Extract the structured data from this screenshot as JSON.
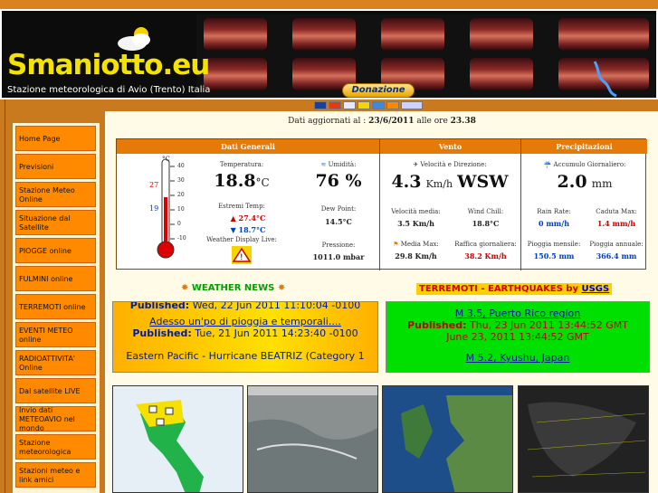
{
  "header": {
    "logo_text": "Smaniotto.eu",
    "subtitle": "Stazione meteorologica di Avio (Trento) Italia",
    "donate_label": "Donazione"
  },
  "colors": {
    "accent": "#e67a08",
    "nav": "#ff8a00",
    "logo": "#f4e200"
  },
  "nav": [
    {
      "label": "Home Page"
    },
    {
      "label": "Previsioni"
    },
    {
      "label": "Stazione Meteo Online"
    },
    {
      "label": "Situazione dal Satellite"
    },
    {
      "label": "PIOGGE online"
    },
    {
      "label": "FULMINI online"
    },
    {
      "label": "TERREMOTI online"
    },
    {
      "label": "EVENTI METEO online"
    },
    {
      "label": "RADIOATTIVITA' Online"
    },
    {
      "label": "Dal satellite LIVE"
    },
    {
      "label": "Invio dati METEOAVIO nel mondo"
    },
    {
      "label": "Stazione meteorologica"
    },
    {
      "label": "Stazioni meteo e link amici"
    }
  ],
  "updated": {
    "prefix": "Dati aggiornati al :",
    "date": "23/6/2011",
    "mid": "alle ore",
    "time": "23.38"
  },
  "weather": {
    "headers": {
      "generali": "Dati Generali",
      "vento": "Vento",
      "precip": "Precipitazioni"
    },
    "thermo": {
      "max": "27",
      "min": "19",
      "scale": [
        "40",
        "30",
        "20",
        "10",
        "0",
        "-10"
      ],
      "unit": "°C"
    },
    "temp_label": "Temperatura:",
    "temp_value": "18.8",
    "temp_unit": "°C",
    "hum_label": "Umidità:",
    "hum_value": "76 %",
    "extremes_label": "Estremi Temp:",
    "temp_max": "27.4°C",
    "temp_min": "18.7°C",
    "dew_label": "Dew Point:",
    "dew_value": "14.5°C",
    "display_label": "Weather Display Live:",
    "press_label": "Pressione:",
    "press_value": "1011.0 mbar",
    "wind_label": "Velocità e Direzione:",
    "wind_value": "4.3",
    "wind_unit": "Km/h",
    "wind_dir": "WSW",
    "avg_label": "Velocità media:",
    "avg_value": "3.5 Km/h",
    "chill_label": "Wind Chill:",
    "chill_value": "18.8°C",
    "maxavg_label": "Media Max:",
    "maxavg_value": "29.8 Km/h",
    "gust_label": "Raffica giornaliera:",
    "gust_value": "38.2 Km/h",
    "rain_label": "Accumulo Giornaliero:",
    "rain_value": "2.0",
    "rain_unit": "mm",
    "rate_label": "Rain Rate:",
    "rate_value": "0 mm/h",
    "fall_label": "Caduta Max:",
    "fall_value": "1.4 mm/h",
    "month_label": "Pioggia mensile:",
    "month_value": "150.5 mm",
    "year_label": "Pioggia annuale:",
    "year_value": "366.4 mm"
  },
  "news": {
    "weather_title": "WEATHER NEWS",
    "eq_title": "TERREMOTI - EARTHQUAKES by",
    "eq_src": "USGS"
  },
  "box1": {
    "line1_pub": "Published:",
    "line1_date": "Wed, 22 Jun 2011 11:10:04 -0100",
    "line2": "Adesso un'po di pioggia e temporali....",
    "line3_pub": "Published:",
    "line3_date": "Tue, 21 Jun 2011 14:23:40 -0100",
    "line4": "Eastern Pacific - Hurricane BEATRIZ (Category 1"
  },
  "box2": {
    "line1": "M 3.5, Puerto Rico region",
    "line2_pub": "Published:",
    "line2_date": "Thu, 23 Jun 2011 13:44:52 GMT",
    "line3": "June 23, 2011 13:44:52 GMT",
    "line4": "M 5.2, Kyushu, Japan"
  }
}
